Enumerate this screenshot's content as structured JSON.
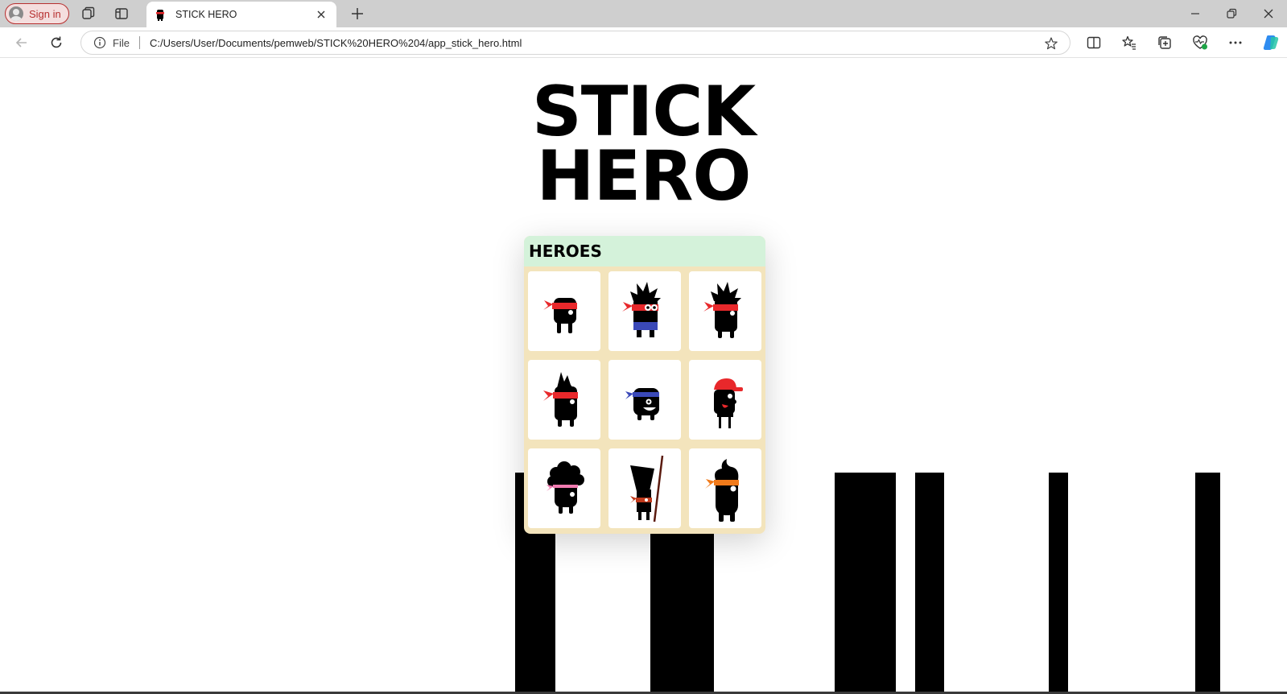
{
  "browser": {
    "signin_label": "Sign in",
    "tab_title": "STICK HERO",
    "address_scheme": "File",
    "url": "C:/Users/User/Documents/pemweb/STICK%20HERO%204/app_stick_hero.html",
    "icons": [
      "workspaces-icon",
      "vertical-tabs-icon",
      "close-tab-icon",
      "new-tab-icon",
      "minimize-icon",
      "restore-icon",
      "close-window-icon",
      "back-icon",
      "refresh-icon",
      "info-icon",
      "favorite-star-icon",
      "split-screen-icon",
      "favorites-icon",
      "collections-icon",
      "browser-essentials-icon",
      "more-icon",
      "copilot-icon"
    ]
  },
  "game": {
    "title_line1": "STICK",
    "title_line2": "HERO",
    "heroes_heading": "HEROES",
    "heroes": [
      {
        "name": "ninja-red-bandana",
        "bandana_color": "#e8282b"
      },
      {
        "name": "spiky-hair-blue-shorts",
        "bandana_color": "#e8282b"
      },
      {
        "name": "spiky-hair-red-bandana",
        "bandana_color": "#e8282b"
      },
      {
        "name": "mohawk-red-bandana",
        "bandana_color": "#e8282b"
      },
      {
        "name": "blue-bandana-smile",
        "bandana_color": "#3a49b8"
      },
      {
        "name": "red-cap-plumber",
        "bandana_color": "#e8282b"
      },
      {
        "name": "afro-pink-bandana",
        "bandana_color": "#f07bb0"
      },
      {
        "name": "tall-hat-with-staff",
        "bandana_color": "#c0391b"
      },
      {
        "name": "swirl-hair-orange-bandana",
        "bandana_color": "#f07a1a"
      }
    ]
  },
  "colors": {
    "panel_header": "#d4f2da",
    "panel_body": "#f3e4bc",
    "pillar": "#000000"
  }
}
